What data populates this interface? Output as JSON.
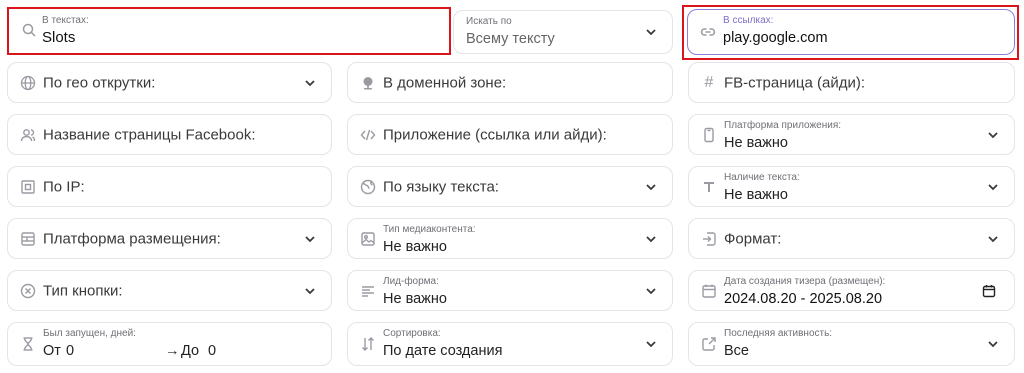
{
  "search_text": {
    "label": "В текстах:",
    "value": "Slots",
    "icon": "search-icon"
  },
  "search_by": {
    "label": "Искать по",
    "value": "Всему тексту"
  },
  "links": {
    "label": "В ссылках:",
    "value": "play.google.com",
    "icon": "link-icon"
  },
  "geo": {
    "label": "По гео открутки:",
    "icon": "globe-icon"
  },
  "domain_zone": {
    "label": "В доменной зоне:",
    "icon": "location-icon"
  },
  "fb_page": {
    "label": "FB-страница (айди):",
    "icon": "hash-icon"
  },
  "fb_page_name": {
    "label": "Название страницы Facebook:",
    "icon": "user-icon"
  },
  "app": {
    "label": "Приложение (ссылка или айди):",
    "icon": "code-icon"
  },
  "app_platform": {
    "label": "Платформа приложения:",
    "value": "Не важно",
    "icon": "phone-icon"
  },
  "ip": {
    "label": "По IP:",
    "icon": "ip-icon"
  },
  "text_language": {
    "label": "По языку текста:",
    "icon": "language-globe-icon"
  },
  "text_presence": {
    "label": "Наличие текста:",
    "value": "Не важно",
    "icon": "text-icon"
  },
  "placement_platform": {
    "label": "Платформа размещения:",
    "icon": "layout-icon"
  },
  "media_type": {
    "label": "Тип медиаконтента:",
    "value": "Не важно",
    "icon": "image-icon"
  },
  "format": {
    "label": "Формат:",
    "icon": "format-icon"
  },
  "button_type": {
    "label": "Тип кнопки:",
    "icon": "cancel-circle-icon"
  },
  "lead_form": {
    "label": "Лид-форма:",
    "value": "Не важно",
    "icon": "lines-icon"
  },
  "creation_date": {
    "label": "Дата создания тизера (размещен):",
    "value": "2024.08.20 - 2025.08.20",
    "icon": "calendar-icon"
  },
  "days_running": {
    "label": "Был запущен, дней:",
    "from_label": "От",
    "from_value": "0",
    "to_label": "До",
    "to_value": "0",
    "icon": "hourglass-icon"
  },
  "sorting": {
    "label": "Сортировка:",
    "value": "По дате создания",
    "icon": "sort-icon"
  },
  "last_activity": {
    "label": "Последняя активность:",
    "value": "Все",
    "icon": "share-icon"
  },
  "colors": {
    "highlight": "#d9141b",
    "focus_border": "#8b7fd6",
    "border": "#e4e4e7"
  }
}
